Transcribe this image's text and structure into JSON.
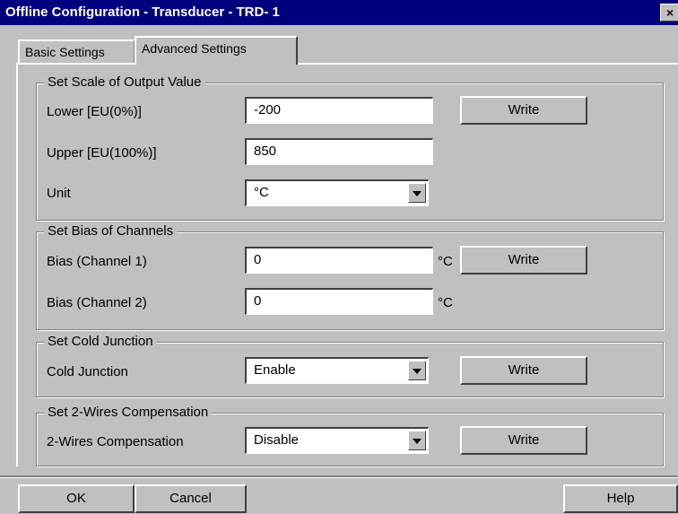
{
  "window": {
    "title": "Offline Configuration - Transducer - TRD- 1",
    "close_label": "×"
  },
  "tabs": [
    {
      "label": "Basic Settings",
      "active": false
    },
    {
      "label": "Advanced Settings",
      "active": true
    }
  ],
  "output_scale": {
    "title": "Set Scale of Output Value",
    "lower_label": "Lower [EU(0%)]",
    "lower_value": "-200",
    "upper_label": "Upper [EU(100%)]",
    "upper_value": "850",
    "unit_label": "Unit",
    "unit_value": "°C",
    "write_label": "Write"
  },
  "bias": {
    "title": "Set Bias of Channels",
    "ch1_label": "Bias (Channel 1)",
    "ch1_value": "0",
    "ch1_unit": "°C",
    "ch2_label": "Bias (Channel 2)",
    "ch2_value": "0",
    "ch2_unit": "°C",
    "write_label": "Write"
  },
  "cold_junction": {
    "title": "Set Cold Junction",
    "label": "Cold Junction",
    "value": "Enable",
    "write_label": "Write"
  },
  "compensation": {
    "title": "Set 2-Wires Compensation",
    "label": "2-Wires Compensation",
    "value": "Disable",
    "write_label": "Write"
  },
  "footer": {
    "ok_label": "OK",
    "cancel_label": "Cancel",
    "help_label": "Help"
  }
}
